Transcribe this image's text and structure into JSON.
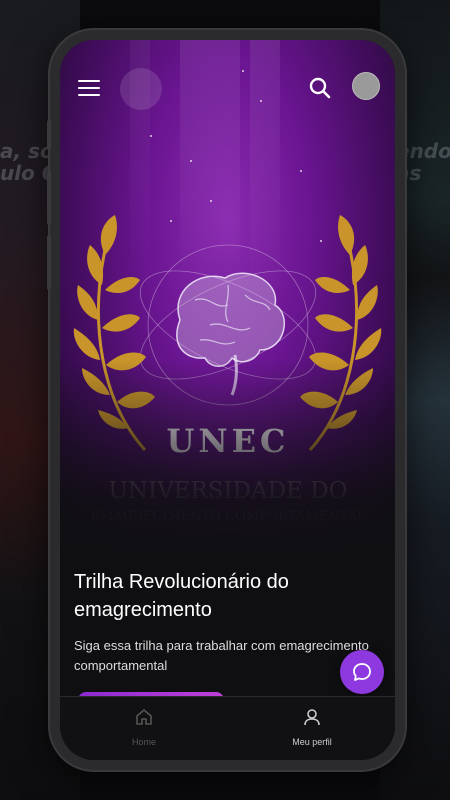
{
  "background": {
    "left_text": "a, sou\nulo Co",
    "right_text": "endo\nas"
  },
  "header": {
    "menu_icon": "hamburger-menu-icon",
    "search_icon": "search-icon",
    "avatar": "user-avatar"
  },
  "hero": {
    "logo_acronym": "UNEC",
    "logo_line1": "UNIVERSIDADE DO",
    "logo_line2": "EMAGRECIMENTO COMPORTAMENTAL"
  },
  "course": {
    "title": "Trilha Revolucionário do emagrecimento",
    "description": "Siga essa trilha para trabalhar com emagrecimento comportamental"
  },
  "chat": {
    "icon": "chat-bubble-icon"
  },
  "nav": {
    "items": [
      {
        "label": "Home",
        "icon": "home-icon",
        "active": false
      },
      {
        "label": "Meu perfil",
        "icon": "user-icon",
        "active": true
      }
    ]
  },
  "colors": {
    "accent": "#8e39e0",
    "hero_purple": "#6a1591",
    "laurel_gold": "#c9952a",
    "background": "#0f0f12"
  }
}
